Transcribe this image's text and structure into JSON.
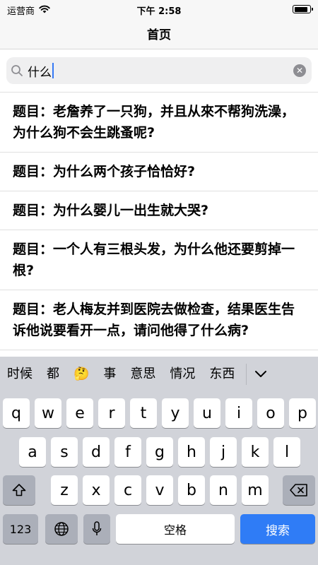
{
  "status_bar": {
    "carrier": "运营商",
    "time": "下午 2:58",
    "battery_level": 0.9
  },
  "nav": {
    "title": "首页"
  },
  "search": {
    "query": "什么"
  },
  "results": [
    "题目：老詹养了一只狗，并且从來不帮狗洗澡，为什么狗不会生跳蚤呢?",
    "题目：为什么两个孩子恰恰好?",
    "题目：为什么婴儿一出生就大哭?",
    "题目：一个人有三根头发，为什么他还要剪掉一根?",
    "题目：老人梅友并到医院去做检查，结果医生告诉他说要看开一点，请问他得了什么病?"
  ],
  "keyboard": {
    "candidates": [
      "时候",
      "都",
      "🤔",
      "事",
      "意思",
      "情况",
      "东西"
    ],
    "row1": [
      "q",
      "w",
      "e",
      "r",
      "t",
      "y",
      "u",
      "i",
      "o",
      "p"
    ],
    "row2": [
      "a",
      "s",
      "d",
      "f",
      "g",
      "h",
      "j",
      "k",
      "l"
    ],
    "row3": [
      "z",
      "x",
      "c",
      "v",
      "b",
      "n",
      "m"
    ],
    "numbers_label": "123",
    "space_label": "空格",
    "search_label": "搜索"
  },
  "colors": {
    "accent": "#2f7cf6",
    "keyboard_bg": "#d1d3d9"
  }
}
